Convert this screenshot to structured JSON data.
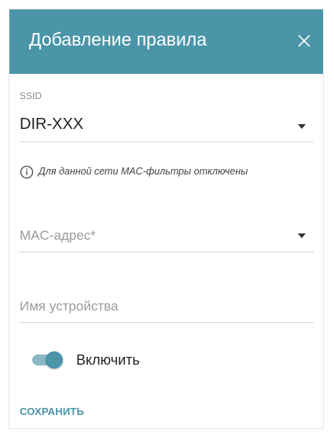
{
  "dialog": {
    "title": "Добавление правила",
    "close_icon": "close-icon",
    "header_color": "#4a95a8"
  },
  "ssid": {
    "label": "SSID",
    "value": "DIR-XXX"
  },
  "info": {
    "icon": "info-icon",
    "text": "Для данной сети MAC-фильтры отключены"
  },
  "mac_field": {
    "placeholder": "MAC-адрес*"
  },
  "device_name_field": {
    "placeholder": "Имя устройства"
  },
  "enable_toggle": {
    "label": "Включить",
    "state": "on"
  },
  "actions": {
    "save_label": "СОХРАНИТЬ"
  },
  "colors": {
    "accent": "#4a95a8"
  }
}
